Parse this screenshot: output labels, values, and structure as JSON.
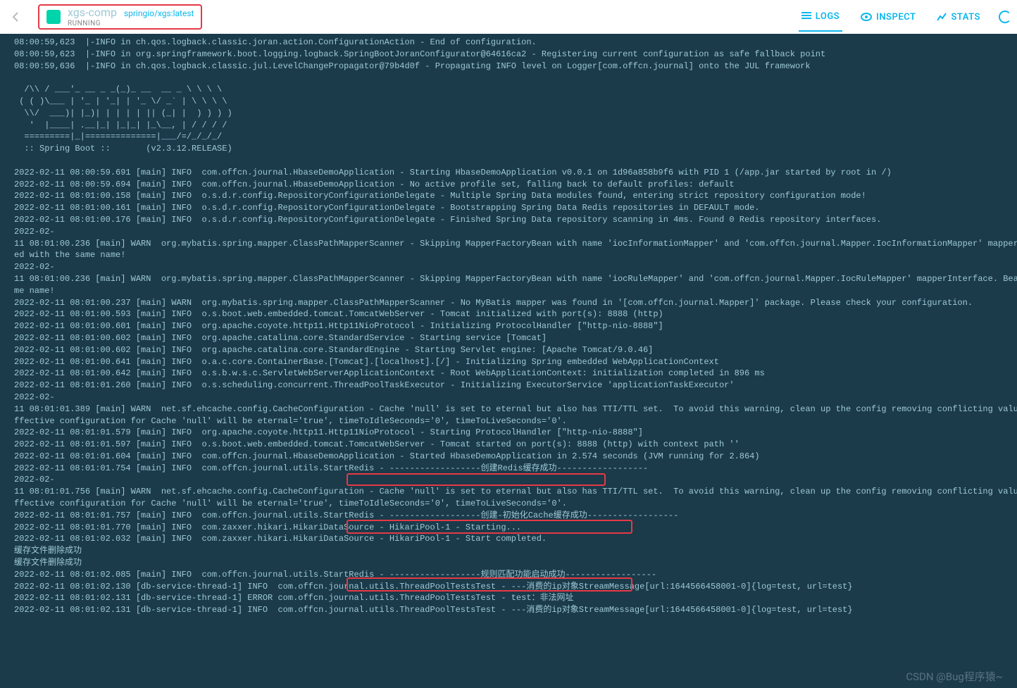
{
  "header": {
    "container_name": "xgs-comp",
    "image": "springio/xgs:latest",
    "status": "RUNNING",
    "tabs": {
      "logs": "LOGS",
      "inspect": "INSPECT",
      "stats": "STATS"
    }
  },
  "watermark": "CSDN @Bug程序猿~",
  "logs": [
    "08:00:59,623  |-INFO in ch.qos.logback.classic.joran.action.ConfigurationAction - End of configuration.",
    "08:00:59,623  |-INFO in org.springframework.boot.logging.logback.SpringBootJoranConfigurator@64616ca2 - Registering current configuration as safe fallback point",
    "08:00:59,636  |-INFO in ch.qos.logback.classic.jul.LevelChangePropagator@79b4d0f - Propagating INFO level on Logger[com.offcn.journal] onto the JUL framework",
    "",
    "  /\\\\ / ___'_ __ _ _(_)_ __  __ _ \\ \\ \\ \\",
    " ( ( )\\___ | '_ | '_| | '_ \\/ _` | \\ \\ \\ \\",
    "  \\\\/  ___)| |_)| | | | | || (_| |  ) ) ) )",
    "   '  |____| .__|_| |_|_| |_\\__, | / / / /",
    "  =========|_|==============|___/=/_/_/_/",
    "  :: Spring Boot ::       (v2.3.12.RELEASE)",
    "",
    "2022-02-11 08:00:59.691 [main] INFO  com.offcn.journal.HbaseDemoApplication - Starting HbaseDemoApplication v0.0.1 on 1d96a858b9f6 with PID 1 (/app.jar started by root in /)",
    "2022-02-11 08:00:59.694 [main] INFO  com.offcn.journal.HbaseDemoApplication - No active profile set, falling back to default profiles: default",
    "2022-02-11 08:01:00.158 [main] INFO  o.s.d.r.config.RepositoryConfigurationDelegate - Multiple Spring Data modules found, entering strict repository configuration mode!",
    "2022-02-11 08:01:00.161 [main] INFO  o.s.d.r.config.RepositoryConfigurationDelegate - Bootstrapping Spring Data Redis repositories in DEFAULT mode.",
    "2022-02-11 08:01:00.176 [main] INFO  o.s.d.r.config.RepositoryConfigurationDelegate - Finished Spring Data repository scanning in 4ms. Found 0 Redis repository interfaces.",
    "2022-02-",
    "11 08:01:00.236 [main] WARN  org.mybatis.spring.mapper.ClassPathMapperScanner - Skipping MapperFactoryBean with name 'iocInformationMapper' and 'com.offcn.journal.Mapper.IocInformationMapper' mapper",
    "ed with the same name!",
    "2022-02-",
    "11 08:01:00.236 [main] WARN  org.mybatis.spring.mapper.ClassPathMapperScanner - Skipping MapperFactoryBean with name 'iocRuleMapper' and 'com.offcn.journal.Mapper.IocRuleMapper' mapperInterface. Bea",
    "me name!",
    "2022-02-11 08:01:00.237 [main] WARN  org.mybatis.spring.mapper.ClassPathMapperScanner - No MyBatis mapper was found in '[com.offcn.journal.Mapper]' package. Please check your configuration.",
    "2022-02-11 08:01:00.593 [main] INFO  o.s.boot.web.embedded.tomcat.TomcatWebServer - Tomcat initialized with port(s): 8888 (http)",
    "2022-02-11 08:01:00.601 [main] INFO  org.apache.coyote.http11.Http11NioProtocol - Initializing ProtocolHandler [\"http-nio-8888\"]",
    "2022-02-11 08:01:00.602 [main] INFO  org.apache.catalina.core.StandardService - Starting service [Tomcat]",
    "2022-02-11 08:01:00.602 [main] INFO  org.apache.catalina.core.StandardEngine - Starting Servlet engine: [Apache Tomcat/9.0.46]",
    "2022-02-11 08:01:00.641 [main] INFO  o.a.c.core.ContainerBase.[Tomcat].[localhost].[/] - Initializing Spring embedded WebApplicationContext",
    "2022-02-11 08:01:00.642 [main] INFO  o.s.b.w.s.c.ServletWebServerApplicationContext - Root WebApplicationContext: initialization completed in 896 ms",
    "2022-02-11 08:01:01.260 [main] INFO  o.s.scheduling.concurrent.ThreadPoolTaskExecutor - Initializing ExecutorService 'applicationTaskExecutor'",
    "2022-02-",
    "11 08:01:01.389 [main] WARN  net.sf.ehcache.config.CacheConfiguration - Cache 'null' is set to eternal but also has TTI/TTL set.  To avoid this warning, clean up the config removing conflicting valu",
    "ffective configuration for Cache 'null' will be eternal='true', timeToIdleSeconds='0', timeToLiveSeconds='0'.",
    "2022-02-11 08:01:01.579 [main] INFO  org.apache.coyote.http11.Http11NioProtocol - Starting ProtocolHandler [\"http-nio-8888\"]",
    "2022-02-11 08:01:01.597 [main] INFO  o.s.boot.web.embedded.tomcat.TomcatWebServer - Tomcat started on port(s): 8888 (http) with context path ''",
    "2022-02-11 08:01:01.604 [main] INFO  com.offcn.journal.HbaseDemoApplication - Started HbaseDemoApplication in 2.574 seconds (JVM running for 2.864)",
    "2022-02-11 08:01:01.754 [main] INFO  com.offcn.journal.utils.StartRedis - ------------------创建Redis缓存成功------------------",
    "2022-02-",
    "11 08:01:01.756 [main] WARN  net.sf.ehcache.config.CacheConfiguration - Cache 'null' is set to eternal but also has TTI/TTL set.  To avoid this warning, clean up the config removing conflicting valu",
    "ffective configuration for Cache 'null' will be eternal='true', timeToIdleSeconds='0', timeToLiveSeconds='0'.",
    "2022-02-11 08:01:01.757 [main] INFO  com.offcn.journal.utils.StartRedis - ------------------创建-初始化Cache缓存成功------------------",
    "2022-02-11 08:01:01.770 [main] INFO  com.zaxxer.hikari.HikariDataSource - HikariPool-1 - Starting...",
    "2022-02-11 08:01:02.032 [main] INFO  com.zaxxer.hikari.HikariDataSource - HikariPool-1 - Start completed.",
    "缓存文件删除成功",
    "缓存文件删除成功",
    "2022-02-11 08:01:02.085 [main] INFO  com.offcn.journal.utils.StartRedis - ------------------规则匹配功能启动成功------------------",
    "2022-02-11 08:01:02.130 [db-service-thread-1] INFO  com.offcn.journal.utils.ThreadPoolTestsTest - ---消费的ip对象StreamMessage[url:1644566458001-0]{log=test, url=test}",
    "2022-02-11 08:01:02.131 [db-service-thread-1] ERROR com.offcn.journal.utils.ThreadPoolTestsTest - test：非法网址",
    "2022-02-11 08:01:02.131 [db-service-thread-1] INFO  com.offcn.journal.utils.ThreadPoolTestsTest - ---消费的ip对象StreamMessage[url:1644566458001-0]{log=test, url=test}"
  ]
}
